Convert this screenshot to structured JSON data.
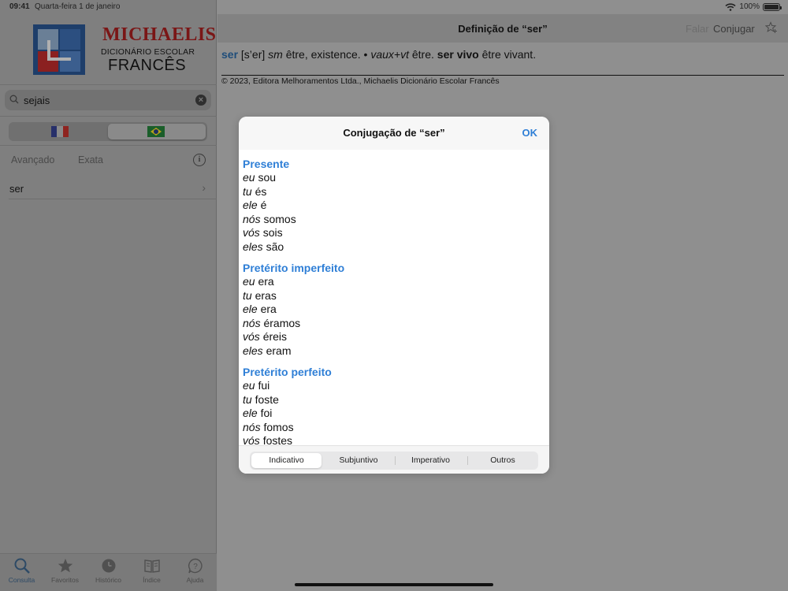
{
  "status": {
    "time": "09:41",
    "date": "Quarta-feira 1 de janeiro",
    "battery": "100%"
  },
  "logo": {
    "brand": "MICHAELIS",
    "subtitle": "DICIONÁRIO ESCOLAR",
    "language": "FRANCÊS"
  },
  "search": {
    "value": "sejais"
  },
  "options": {
    "advanced": "Avançado",
    "exact": "Exata"
  },
  "results": [
    {
      "label": "ser"
    }
  ],
  "tabs": [
    {
      "label": "Consulta",
      "icon": "search-icon"
    },
    {
      "label": "Favoritos",
      "icon": "star-icon"
    },
    {
      "label": "Histórico",
      "icon": "clock-icon"
    },
    {
      "label": "Índice",
      "icon": "book-icon"
    },
    {
      "label": "Ajuda",
      "icon": "help-icon"
    }
  ],
  "navbar": {
    "title": "Definição de “ser”",
    "speak": "Falar",
    "conjugate": "Conjugar"
  },
  "definition": {
    "headword": "ser",
    "pron": "[s’er]",
    "pos1": "sm",
    "sense1": "être, existence. •",
    "pos2": "vaux+vt",
    "sense2": "être.",
    "phrase": "ser vivo",
    "phrase_tr": "être vivant."
  },
  "copyright": "© 2023, Editora Melhoramentos Ltda., Michaelis Dicionário Escolar Francês",
  "modal": {
    "title": "Conjugação de “ser”",
    "ok": "OK",
    "sections": [
      {
        "title": "Presente",
        "forms": [
          [
            "eu",
            "sou"
          ],
          [
            "tu",
            "és"
          ],
          [
            "ele",
            "é"
          ],
          [
            "nós",
            "somos"
          ],
          [
            "vós",
            "sois"
          ],
          [
            "eles",
            "são"
          ]
        ]
      },
      {
        "title": "Pretérito imperfeito",
        "forms": [
          [
            "eu",
            "era"
          ],
          [
            "tu",
            "eras"
          ],
          [
            "ele",
            "era"
          ],
          [
            "nós",
            "éramos"
          ],
          [
            "vós",
            "éreis"
          ],
          [
            "eles",
            "eram"
          ]
        ]
      },
      {
        "title": "Pretérito perfeito",
        "forms": [
          [
            "eu",
            "fui"
          ],
          [
            "tu",
            "foste"
          ],
          [
            "ele",
            "foi"
          ],
          [
            "nós",
            "fomos"
          ],
          [
            "vós",
            "fostes"
          ]
        ]
      }
    ],
    "moods": [
      "Indicativo",
      "Subjuntivo",
      "Imperativo",
      "Outros"
    ],
    "selected_mood": "Indicativo"
  },
  "colors": {
    "accent": "#2f7fd6",
    "brand": "#7a1616"
  }
}
